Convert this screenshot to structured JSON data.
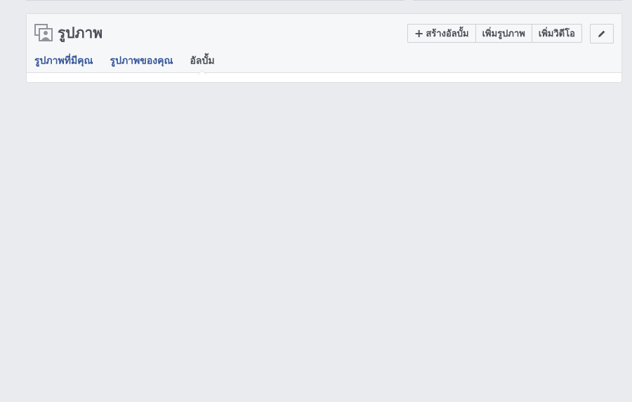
{
  "section": {
    "title": "รูปภาพ",
    "icon": "photos-icon"
  },
  "actions": {
    "create_album": "สร้างอัลบั้ม",
    "add_photos": "เพิ่มรูปภาพ",
    "add_video": "เพิ่มวิดีโอ",
    "edit_icon": "pencil-icon"
  },
  "tabs": [
    {
      "label": "รูปภาพที่มีคุณ",
      "active": false
    },
    {
      "label": "รูปภาพของคุณ",
      "active": false
    },
    {
      "label": "อัลบั้ม",
      "active": true
    }
  ],
  "colors": {
    "background": "#e9ebee",
    "link": "#365899",
    "text": "#4b4f56"
  }
}
